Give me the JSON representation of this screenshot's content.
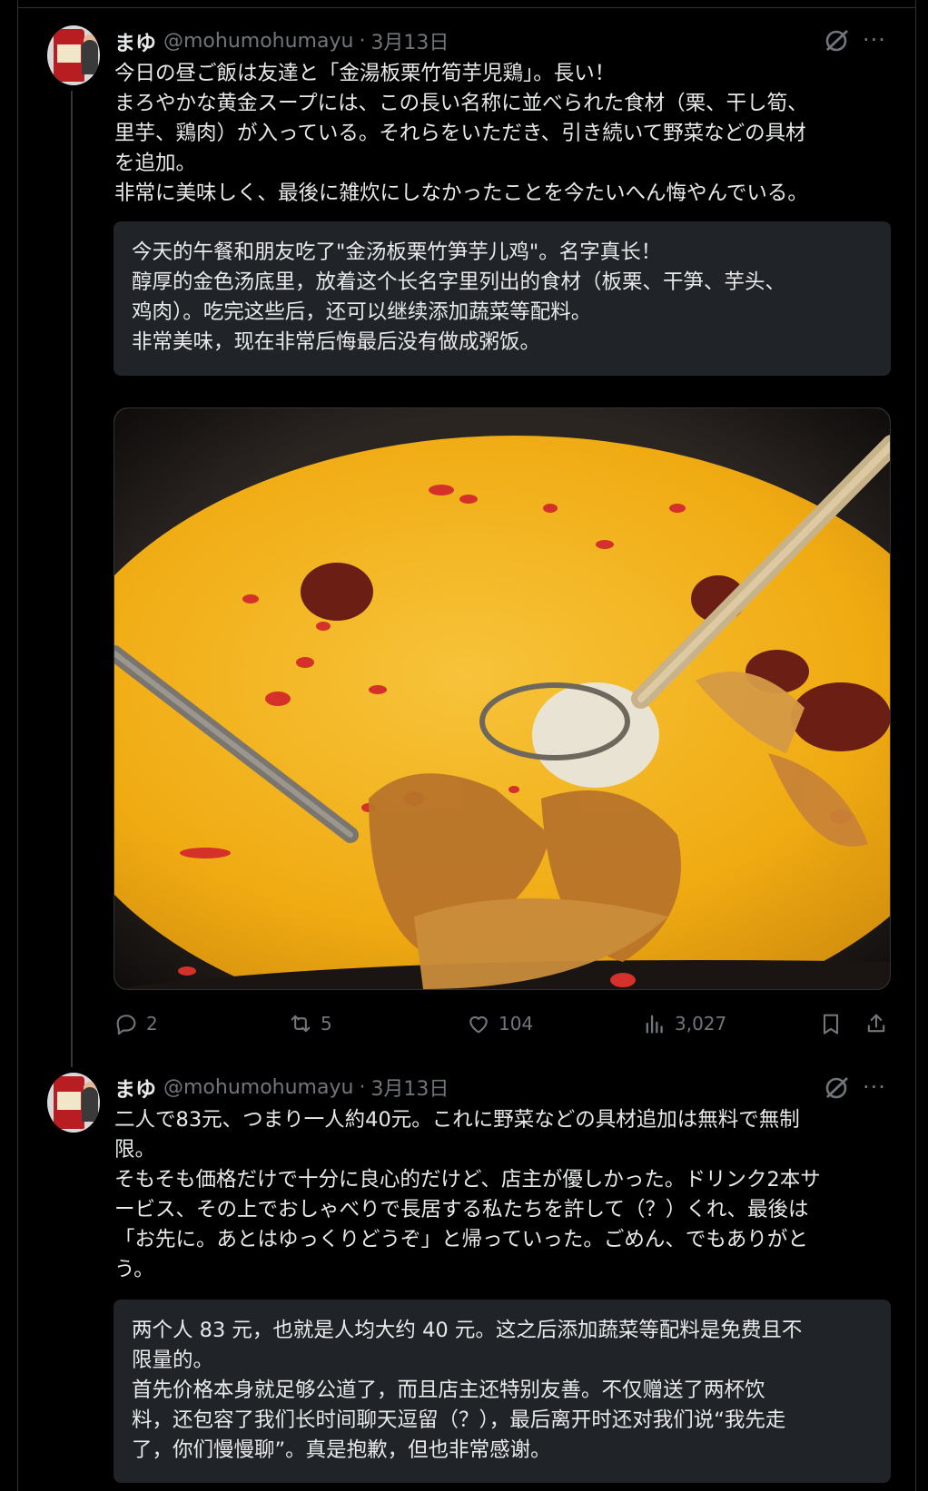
{
  "colors": {
    "background": "#000000",
    "text": "#e7e9ea",
    "muted": "#71767b",
    "translation_bg": "#202327",
    "soup": "#f2b21a"
  },
  "posts": [
    {
      "author": {
        "name": "まゆ",
        "handle": "@mohumohumayu",
        "date": "3月13日",
        "avatar_icon": "liquor-bottle-avatar"
      },
      "body": "今日の昼ご飯は友達と「金湯板栗竹筍芋児鶏」。長い！\nまろやかな黄金スープには、この長い名称に並べられた食材（栗、干し筍、\n里芋、鶏肉）が入っている。それらをいただき、引き続いて野菜などの具材\nを追加。\n非常に美味しく、最後に雑炊にしなかったことを今たいへん悔やんでいる。",
      "translation": "今天的午餐和朋友吃了\"金汤板栗竹笋芋儿鸡\"。名字真长！\n醇厚的金色汤底里，放着这个长名字里列出的食材（板栗、干笋、芋头、\n鸡肉）。吃完这些后，还可以继续添加蔬菜等配料。\n非常美味，现在非常后悔最后没有做成粥饭。",
      "image_icon": "golden-soup-hotpot-photo",
      "stats": {
        "replies": "2",
        "reposts": "5",
        "likes": "104",
        "views": "3,027"
      }
    },
    {
      "author": {
        "name": "まゆ",
        "handle": "@mohumohumayu",
        "date": "3月13日",
        "avatar_icon": "liquor-bottle-avatar"
      },
      "body": "二人で83元、つまり一人約40元。これに野菜などの具材追加は無料で無制\n限。\nそもそも価格だけで十分に良心的だけど、店主が優しかった。ドリンク2本サ\nービス、その上でおしゃべりで長居する私たちを許して（？）くれ、最後は\n「お先に。あとはゆっくりどうぞ」と帰っていった。ごめん、でもありがと\nう。",
      "translation": "两个人 83 元，也就是人均大约 40 元。这之后添加蔬菜等配料是免费且不\n限量的。\n首先价格本身就足够公道了，而且店主还特别友善。不仅赠送了两杯饮\n料，还包容了我们长时间聊天逗留（？），最后离开时还对我们说“我先走\n了，你们慢慢聊”。真是抱歉，但也非常感谢。"
    }
  ]
}
